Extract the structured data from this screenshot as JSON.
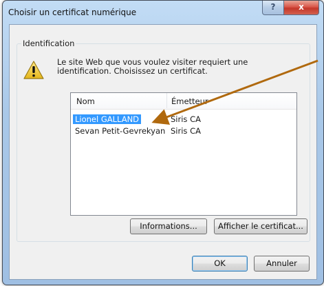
{
  "window": {
    "title": "Choisir un certificat numérique",
    "help_label": "?",
    "close_label": "x"
  },
  "group": {
    "label": "Identification",
    "message_line1": "Le site Web que vous voulez visiter requiert une",
    "message_line2": "identification. Choisissez un certificat."
  },
  "table": {
    "columns": [
      "Nom",
      "Émetteur"
    ],
    "rows": [
      {
        "name": "Lionel GALLAND",
        "issuer": "Siris CA",
        "selected": true
      },
      {
        "name": "Sevan Petit-Gevrekyan",
        "issuer": "Siris CA",
        "selected": false
      }
    ]
  },
  "buttons": {
    "info": "Informations...",
    "view_cert": "Afficher le certificat...",
    "ok": "OK",
    "cancel": "Annuler"
  },
  "colors": {
    "selection": "#3399ff",
    "annotation_arrow": "#b0690e",
    "close_button": "#c4372a"
  },
  "icons": {
    "warning": "warning-icon",
    "help": "help-icon",
    "close": "close-icon"
  }
}
